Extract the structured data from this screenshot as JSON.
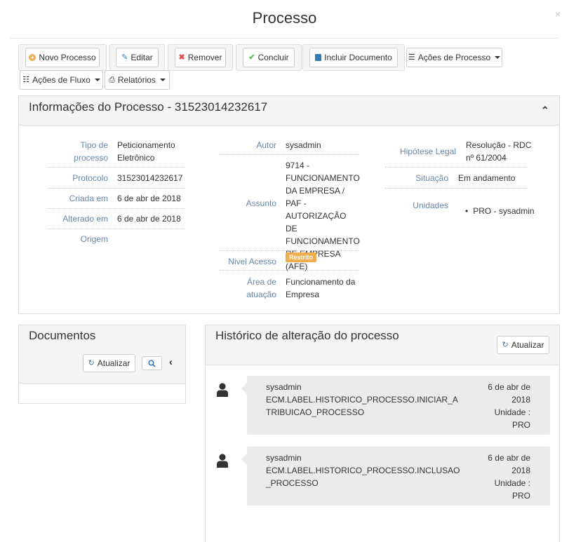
{
  "modal": {
    "title": "Processo",
    "close": "×"
  },
  "toolbar": {
    "novo_processo": "Novo Processo",
    "editar": "Editar",
    "remover": "Remover",
    "concluir": "Concluir",
    "incluir_documento": "Incluir Documento",
    "acoes_processo": "Ações de Processo",
    "acoes_fluxo": "Ações de Fluxo",
    "relatorios": "Relatórios"
  },
  "colors": {
    "label": "#6787a8",
    "badge": "#f0ad4e",
    "new_icon": "#f0ad4e",
    "remove_icon": "#d9534f",
    "ok_icon": "#5cb85c",
    "link_icon": "#337ab7"
  },
  "info": {
    "title": "Informações do Processo - 31523014232617",
    "tipo_label": "Tipo de processo",
    "tipo_value": "Peticionamento Eletrônico",
    "protocolo_label": "Protocolo",
    "protocolo_value": "31523014232617",
    "criada_label": "Criada em",
    "criada_value": "6 de abr de 2018",
    "alterado_label": "Alterado em",
    "alterado_value": "6 de abr de 2018",
    "origem_label": "Origem",
    "autor_label": "Autor",
    "autor_value": "sysadmin",
    "assunto_label": "Assunto",
    "assunto_value": "9714 - FUNCIONAMENTO DA EMPRESA / PAF - AUTORIZAÇÃO DE FUNCIONAMENTO DE EMPRESA (AFE)",
    "nivel_label": "Nivel Acesso",
    "nivel_value": "Restrito",
    "area_label": "Área de atuação",
    "area_value": "Funcionamento da Empresa",
    "hipotese_label": "Hipótese Legal",
    "hipotese_value": "Resolução - RDC nº 61/2004",
    "situacao_label": "Situação",
    "situacao_value": "Em andamento",
    "unidades_label": "Unidades",
    "unidades_value": "PRO - sysadmin"
  },
  "documentos": {
    "title": "Documentos",
    "atualizar": "Atualizar"
  },
  "historico": {
    "title": "Histórico de alteração do processo",
    "atualizar": "Atualizar",
    "items": [
      {
        "user": "sysadmin",
        "action": "ECM.LABEL.HISTORICO_PROCESSO.INICIAR_ATRIBUICAO_PROCESSO",
        "date": "6 de abr de 2018",
        "unidade": "Unidade : PRO"
      },
      {
        "user": "sysadmin",
        "action": "ECM.LABEL.HISTORICO_PROCESSO.INCLUSAO_PROCESSO",
        "date": "6 de abr de 2018",
        "unidade": "Unidade : PRO"
      }
    ]
  }
}
